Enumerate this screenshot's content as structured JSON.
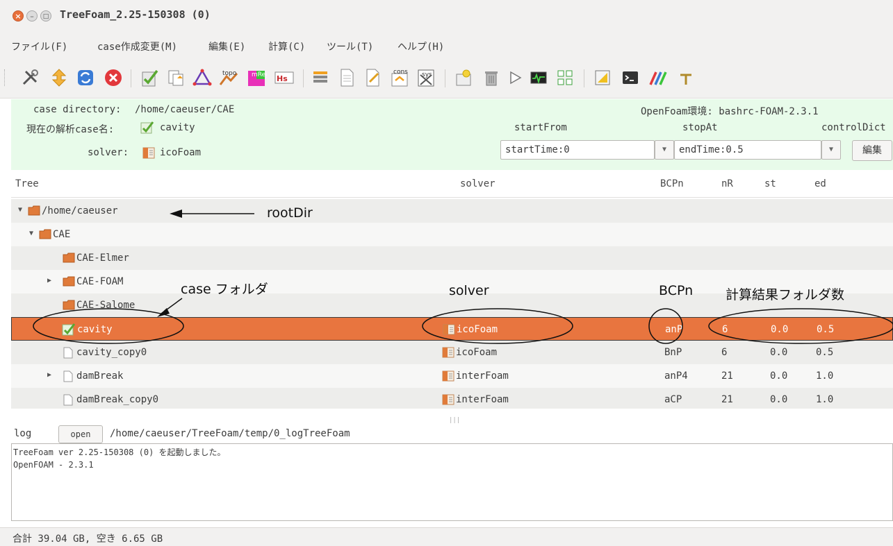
{
  "window": {
    "title": "TreeFoam_2.25-150308 (0)"
  },
  "menu": [
    "ファイル(F)",
    "case作成変更(M)",
    "編集(E)",
    "計算(C)",
    "ツール(T)",
    "ヘルプ(H)"
  ],
  "toolbar": {
    "labels": {
      "topo": "topo",
      "mreg": "mReg",
      "hs": "Hs",
      "cons": "cons",
      "sys": "sys"
    }
  },
  "info": {
    "case_directory_label": "case directory:",
    "case_directory": "/home/caeuser/CAE",
    "openfoam_env": "OpenFoam環境: bashrc-FOAM-2.3.1",
    "current_case_label": "現在の解析case名:",
    "current_case": "cavity",
    "solver_label": "solver:",
    "solver": "icoFoam",
    "startFrom_label": "startFrom",
    "stopAt_label": "stopAt",
    "controlDict_label": "controlDict",
    "startFrom_value": "startTime:0",
    "stopAt_value": "endTime:0.5",
    "edit_button": "編集"
  },
  "tree": {
    "headers": {
      "tree": "Tree",
      "solver": "solver",
      "bcpn": "BCPn",
      "nr": "nR",
      "st": "st",
      "ed": "ed"
    },
    "rows": [
      {
        "name": "/home/caeuser",
        "solver": "",
        "bcpn": "",
        "nr": "",
        "st": "",
        "ed": ""
      },
      {
        "name": "CAE",
        "solver": "",
        "bcpn": "",
        "nr": "",
        "st": "",
        "ed": ""
      },
      {
        "name": "CAE-Elmer",
        "solver": "",
        "bcpn": "",
        "nr": "",
        "st": "",
        "ed": ""
      },
      {
        "name": "CAE-FOAM",
        "solver": "",
        "bcpn": "",
        "nr": "",
        "st": "",
        "ed": ""
      },
      {
        "name": "CAE-Salome",
        "solver": "",
        "bcpn": "",
        "nr": "",
        "st": "",
        "ed": ""
      },
      {
        "name": "cavity",
        "solver": "icoFoam",
        "bcpn": "anP",
        "nr": "6",
        "st": "0.0",
        "ed": "0.5"
      },
      {
        "name": "cavity_copy0",
        "solver": "icoFoam",
        "bcpn": "BnP",
        "nr": "6",
        "st": "0.0",
        "ed": "0.5"
      },
      {
        "name": "damBreak",
        "solver": "interFoam",
        "bcpn": "anP4",
        "nr": "21",
        "st": "0.0",
        "ed": "1.0"
      },
      {
        "name": "damBreak_copy0",
        "solver": "interFoam",
        "bcpn": "aCP",
        "nr": "21",
        "st": "0.0",
        "ed": "1.0"
      }
    ]
  },
  "log": {
    "label": "log",
    "open_button": "open",
    "path": "/home/caeuser/TreeFoam/temp/0_logTreeFoam",
    "lines": [
      "TreeFoam ver 2.25-150308  (0) を起動しました。",
      "OpenFOAM - 2.3.1"
    ]
  },
  "status": "合計 39.04 GB,  空き 6.65 GB",
  "annotations": {
    "rootdir": "rootDir",
    "case_folder": "case フォルダ",
    "solver": "solver",
    "bcpn": "BCPn",
    "results": "計算結果フォルダ数"
  },
  "colors": {
    "selected_row": "#e8753f",
    "info_panel": "#e8fbea",
    "folder": "#e07b3a"
  }
}
